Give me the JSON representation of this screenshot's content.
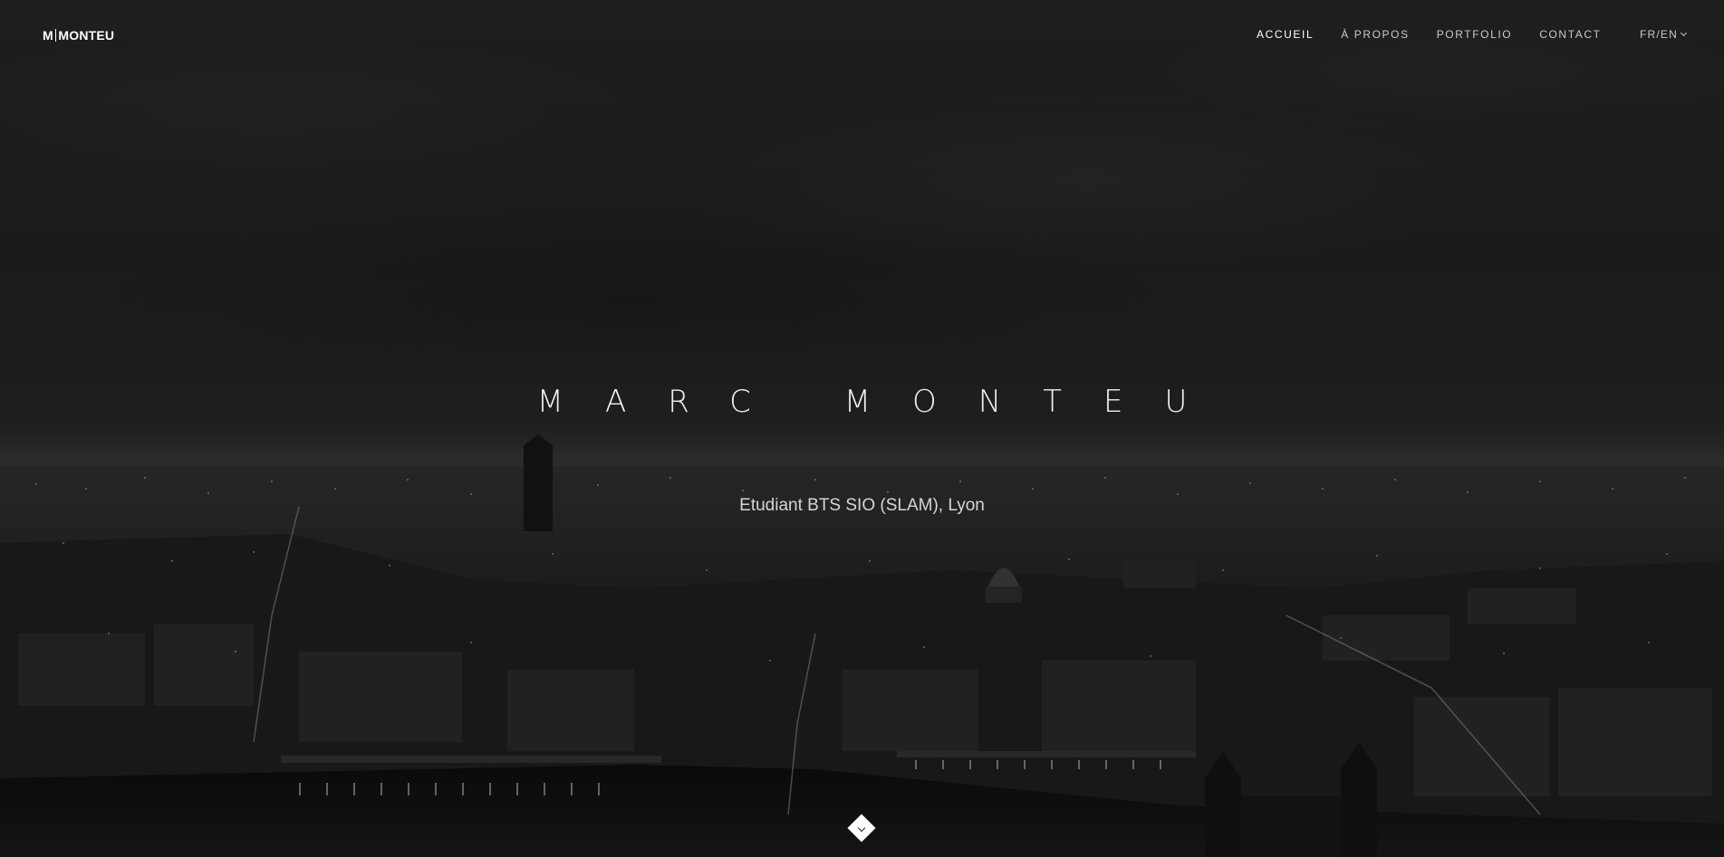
{
  "logo": {
    "left": "M",
    "right": "MONTEU"
  },
  "nav": {
    "items": [
      {
        "label": "ACCUEIL",
        "active": true
      },
      {
        "label": "À PROPOS",
        "active": false
      },
      {
        "label": "PORTFOLIO",
        "active": false
      },
      {
        "label": "CONTACT",
        "active": false
      }
    ],
    "language": "FR/EN"
  },
  "hero": {
    "title": "MARC MONTEU",
    "subtitle": "Etudiant BTS SIO (SLAM), Lyon"
  },
  "icons": {
    "language_toggle": "chevron-down-icon",
    "scroll_down": "chevron-down-icon"
  },
  "colors": {
    "background": "#1a1a1a",
    "text": "#ffffff",
    "nav_text": "#c9c9c9"
  }
}
